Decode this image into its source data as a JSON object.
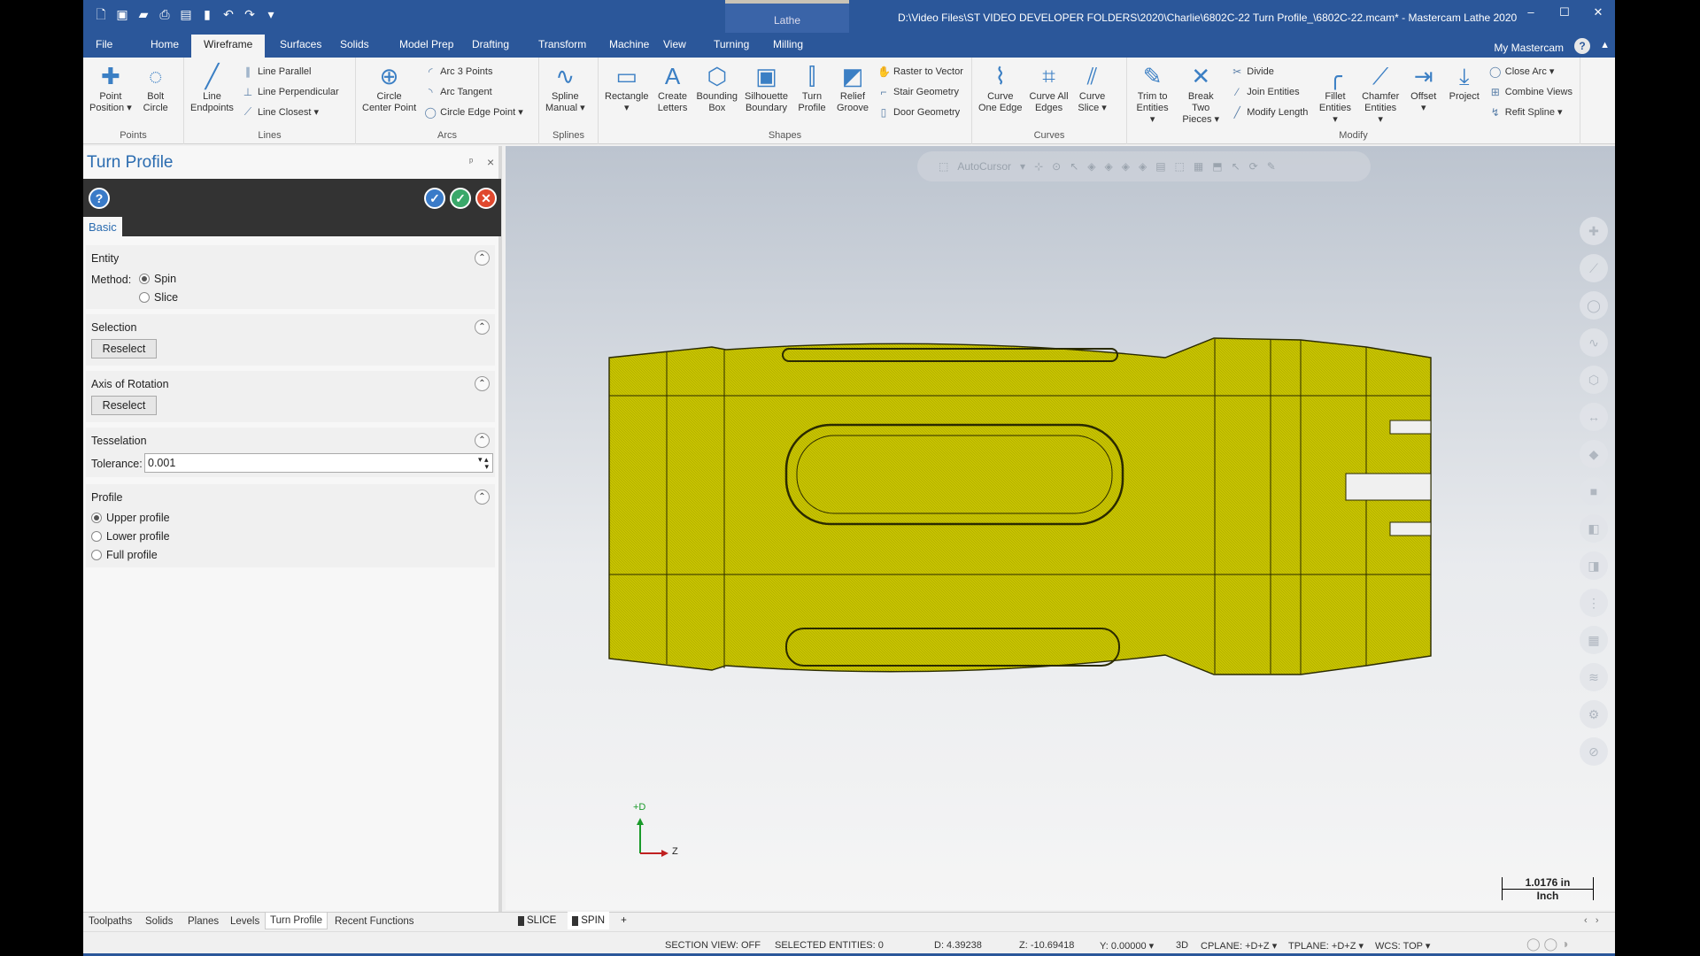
{
  "titlebar": {
    "context_tab": "Lathe",
    "title": "D:\\Video Files\\ST VIDEO DEVELOPER FOLDERS\\2020\\Charlie\\6802C-22 Turn Profile_\\6802C-22.mcam* - Mastercam Lathe 2020",
    "minimize": "–",
    "maximize": "☐",
    "close": "✕"
  },
  "ribbon_tabs": [
    "File",
    "Home",
    "Wireframe",
    "Surfaces",
    "Solids",
    "Model Prep",
    "Drafting",
    "Transform",
    "Machine",
    "View",
    "Turning",
    "Milling"
  ],
  "active_tab": "Wireframe",
  "my_mastercam": "My Mastercam",
  "ribbon_groups": [
    {
      "name": "Points",
      "width": 114,
      "items": [
        {
          "type": "large",
          "label": "Point\nPosition ▾",
          "icon": "✚"
        },
        {
          "type": "large",
          "label": "Bolt\nCircle",
          "icon": "◌"
        }
      ]
    },
    {
      "name": "Lines",
      "width": 194,
      "items": [
        {
          "type": "large",
          "label": "Line\nEndpoints",
          "icon": "╱"
        },
        {
          "type": "stack",
          "rows": [
            {
              "label": "Line Parallel",
              "icon": "∥"
            },
            {
              "label": "Line Perpendicular",
              "icon": "⊥"
            },
            {
              "label": "Line Closest ▾",
              "icon": "⟋"
            }
          ]
        }
      ]
    },
    {
      "name": "Arcs",
      "width": 207,
      "items": [
        {
          "type": "large",
          "label": "Circle\nCenter Point",
          "icon": "⊕"
        },
        {
          "type": "stack",
          "rows": [
            {
              "label": "Arc 3 Points",
              "icon": "◜"
            },
            {
              "label": "Arc Tangent",
              "icon": "◝"
            },
            {
              "label": "Circle Edge Point ▾",
              "icon": "◯"
            }
          ]
        }
      ]
    },
    {
      "name": "Splines",
      "width": 67,
      "items": [
        {
          "type": "large",
          "label": "Spline\nManual ▾",
          "icon": "∿"
        }
      ]
    },
    {
      "name": "Shapes",
      "width": 422,
      "items": [
        {
          "type": "large",
          "label": "Rectangle\n▾",
          "icon": "▭"
        },
        {
          "type": "large",
          "label": "Create\nLetters",
          "icon": "A"
        },
        {
          "type": "large",
          "label": "Bounding\nBox",
          "icon": "⬡"
        },
        {
          "type": "large",
          "label": "Silhouette\nBoundary",
          "icon": "▣"
        },
        {
          "type": "large",
          "label": "Turn\nProfile",
          "icon": "⫿"
        },
        {
          "type": "large",
          "label": "Relief\nGroove",
          "icon": "◩"
        },
        {
          "type": "stack",
          "rows": [
            {
              "label": "Raster to Vector",
              "icon": "✋"
            },
            {
              "label": "Stair Geometry",
              "icon": "⌐"
            },
            {
              "label": "Door Geometry",
              "icon": "▯"
            }
          ]
        }
      ]
    },
    {
      "name": "Curves",
      "width": 175,
      "items": [
        {
          "type": "large",
          "label": "Curve\nOne Edge",
          "icon": "⌇"
        },
        {
          "type": "large",
          "label": "Curve All\nEdges",
          "icon": "⌗"
        },
        {
          "type": "large",
          "label": "Curve\nSlice ▾",
          "icon": "⫽"
        }
      ]
    },
    {
      "name": "Modify",
      "width": 512,
      "items": [
        {
          "type": "large",
          "label": "Trim to\nEntities ▾",
          "icon": "✎"
        },
        {
          "type": "large",
          "label": "Break Two\nPieces ▾",
          "icon": "✕"
        },
        {
          "type": "stack",
          "rows": [
            {
              "label": "Divide",
              "icon": "✂"
            },
            {
              "label": "Join Entities",
              "icon": "⁄"
            },
            {
              "label": "Modify Length",
              "icon": "╱"
            }
          ]
        },
        {
          "type": "large",
          "label": "Fillet\nEntities ▾",
          "icon": "╭"
        },
        {
          "type": "large",
          "label": "Chamfer\nEntities ▾",
          "icon": "⟋"
        },
        {
          "type": "large",
          "label": "Offset\n▾",
          "icon": "⇥"
        },
        {
          "type": "large",
          "label": "Project",
          "icon": "⤓"
        },
        {
          "type": "stack",
          "rows": [
            {
              "label": "Close Arc ▾",
              "icon": "◯"
            },
            {
              "label": "Combine Views",
              "icon": "⊞"
            },
            {
              "label": "Refit Spline ▾",
              "icon": "↯"
            }
          ]
        }
      ]
    }
  ],
  "panel": {
    "title": "Turn Profile",
    "pin": "ᵖ",
    "close": "×",
    "help": "?",
    "ok_new": "✓",
    "ok": "✓",
    "cancel": "✕",
    "tab": "Basic",
    "entity": {
      "title": "Entity",
      "method_label": "Method:",
      "options": [
        "Spin",
        "Slice"
      ],
      "selected": "Spin"
    },
    "selection": {
      "title": "Selection",
      "button": "Reselect"
    },
    "axis": {
      "title": "Axis of Rotation",
      "button": "Reselect"
    },
    "tesselation": {
      "title": "Tesselation",
      "tolerance_label": "Tolerance:",
      "tolerance": "0.001"
    },
    "profile": {
      "title": "Profile",
      "options": [
        "Upper profile",
        "Lower profile",
        "Full profile"
      ],
      "selected": "Upper profile"
    }
  },
  "viewport": {
    "autocursor": "AutoCursor",
    "axis_up": "+D",
    "axis_right": "Z",
    "scale_value": "1.0176 in",
    "scale_unit": "Inch",
    "part_color": "#c8c400"
  },
  "bottom_tabs": [
    "Toolpaths",
    "Solids",
    "Planes",
    "Levels",
    "Turn Profile",
    "Recent Functions"
  ],
  "active_bottom_tab": "Turn Profile",
  "view_tabs": [
    "SLICE",
    "SPIN",
    "+"
  ],
  "status": {
    "section_view": "SECTION VIEW: OFF",
    "selected": "SELECTED ENTITIES: 0",
    "d": "D:  4.39238",
    "z": "Z:  -10.69418",
    "y": "Y:  0.00000  ▾",
    "mode": "3D",
    "cplane": "CPLANE: +D+Z  ▾",
    "tplane": "TPLANE: +D+Z  ▾",
    "wcs": "WCS: TOP  ▾"
  }
}
